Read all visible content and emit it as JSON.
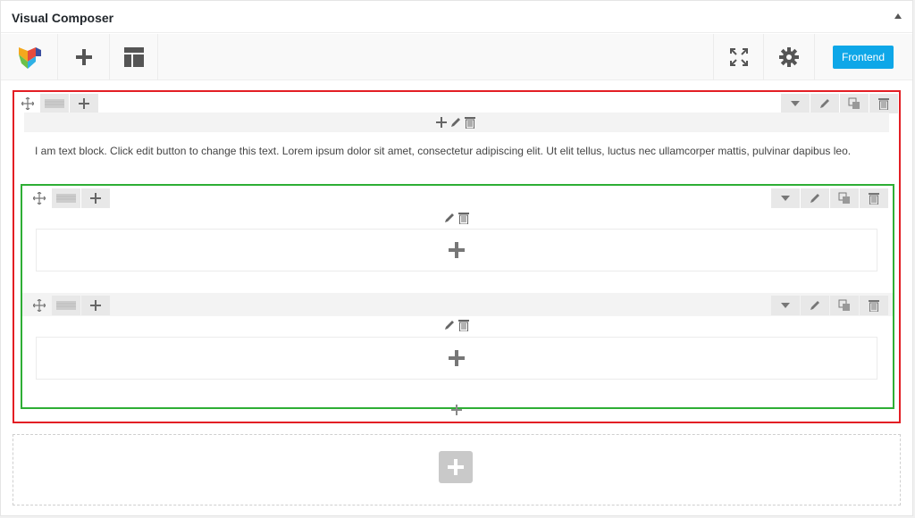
{
  "panel": {
    "title": "Visual Composer",
    "collapse_icon": "triangle-up-icon"
  },
  "navbar": {
    "logo_icon": "vc-logo-icon",
    "add_element_icon": "plus-icon",
    "templates_icon": "layout-icon",
    "fullscreen_icon": "fullscreen-icon",
    "settings_icon": "gear-icon",
    "frontend_label": "Frontend"
  },
  "row": {
    "text_block": "I am text block. Click edit button to change this text. Lorem ipsum dolor sit amet, consectetur adipiscing elit. Ut elit tellus, luctus nec ullamcorper mattis, pulvinar dapibus leo."
  },
  "colors": {
    "row_highlight": "#e31e24",
    "inner_row_highlight": "#2eae35",
    "frontend_button": "#0ea7e8"
  }
}
